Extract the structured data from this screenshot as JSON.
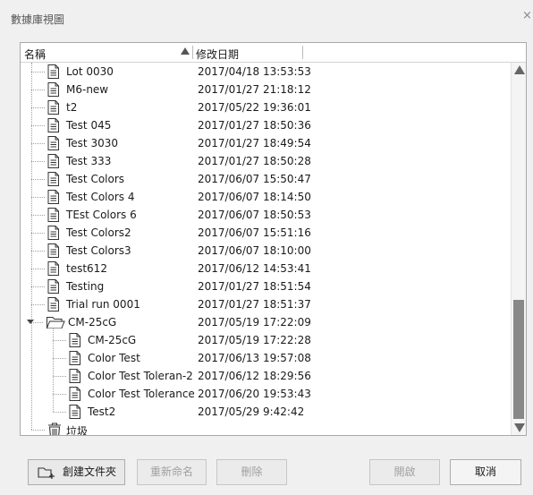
{
  "window": {
    "title": "數據庫視圖",
    "close_glyph": "×"
  },
  "columns": {
    "name": "名稱",
    "date": "修改日期"
  },
  "items": [
    {
      "label": "Lot 0030",
      "date": "2017/04/18 13:53:53",
      "kind": "file",
      "level": 1
    },
    {
      "label": "M6-new",
      "date": "2017/01/27 21:18:12",
      "kind": "file",
      "level": 1
    },
    {
      "label": "t2",
      "date": "2017/05/22 19:36:01",
      "kind": "file",
      "level": 1
    },
    {
      "label": "Test 045",
      "date": "2017/01/27 18:50:36",
      "kind": "file",
      "level": 1
    },
    {
      "label": "Test 3030",
      "date": "2017/01/27 18:49:54",
      "kind": "file",
      "level": 1
    },
    {
      "label": "Test 333",
      "date": "2017/01/27 18:50:28",
      "kind": "file",
      "level": 1
    },
    {
      "label": "Test Colors",
      "date": "2017/06/07 15:50:47",
      "kind": "file",
      "level": 1
    },
    {
      "label": "Test Colors 4",
      "date": "2017/06/07 18:14:50",
      "kind": "file",
      "level": 1
    },
    {
      "label": "TEst Colors 6",
      "date": "2017/06/07 18:50:53",
      "kind": "file",
      "level": 1
    },
    {
      "label": "Test Colors2",
      "date": "2017/06/07 15:51:16",
      "kind": "file",
      "level": 1
    },
    {
      "label": "Test Colors3",
      "date": "2017/06/07 18:10:00",
      "kind": "file",
      "level": 1
    },
    {
      "label": "test612",
      "date": "2017/06/12 14:53:41",
      "kind": "file",
      "level": 1
    },
    {
      "label": "Testing",
      "date": "2017/01/27 18:51:54",
      "kind": "file",
      "level": 1
    },
    {
      "label": "Trial run 0001",
      "date": "2017/01/27 18:51:37",
      "kind": "file",
      "level": 1
    },
    {
      "label": "CM-25cG",
      "date": "2017/05/19 17:22:09",
      "kind": "folder",
      "level": 1,
      "expanded": true
    },
    {
      "label": "CM-25cG",
      "date": "2017/05/19 17:22:28",
      "kind": "file",
      "level": 2
    },
    {
      "label": "Color Test",
      "date": "2017/06/13 19:57:08",
      "kind": "file",
      "level": 2
    },
    {
      "label": "Color Test Toleran-2",
      "date": "2017/06/12 18:29:56",
      "kind": "file",
      "level": 2
    },
    {
      "label": "Color Test Tolerance",
      "date": "2017/06/20 19:53:43",
      "kind": "file",
      "level": 2
    },
    {
      "label": "Test2",
      "date": "2017/05/29 9:42:42",
      "kind": "file",
      "level": 2
    },
    {
      "label": "垃圾",
      "date": "",
      "kind": "trash",
      "level": 1
    }
  ],
  "buttons": {
    "create_folder": "創建文件夾",
    "rename": "重新命名",
    "delete": "刪除",
    "open": "開啟",
    "cancel": "取消"
  },
  "icons": {
    "file": "document-icon",
    "folder": "folder-icon",
    "trash": "trash-icon",
    "create_folder": "new-folder-icon",
    "expand": "triangle-down-icon"
  },
  "colors": {
    "tree_line": "#a0a0a0",
    "thumb": "#888888",
    "disabled_text": "#a0a0a0"
  }
}
